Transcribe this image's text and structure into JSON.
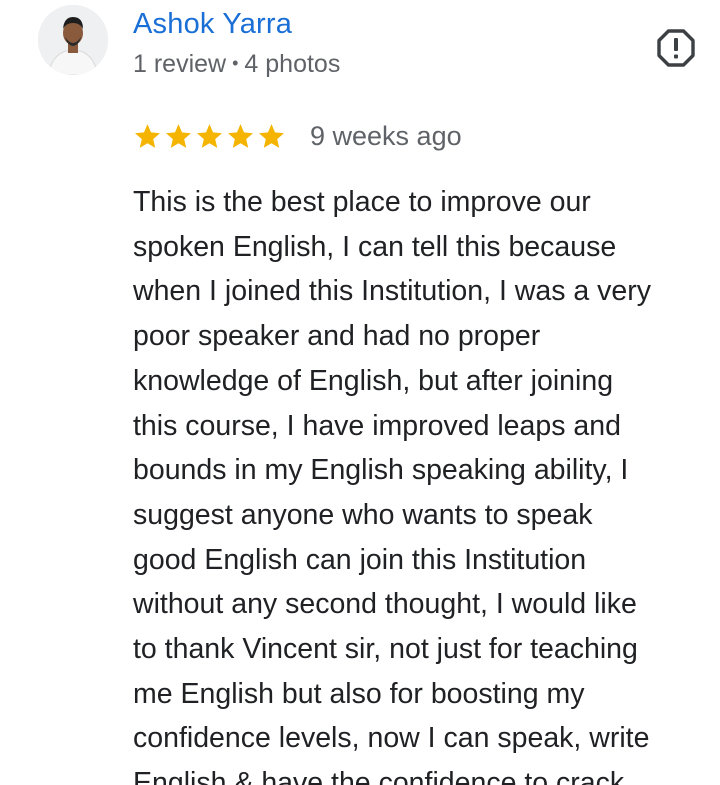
{
  "author": {
    "name": "Ashok Yarra",
    "reviews": "1 review",
    "separator": "•",
    "photos": "4 photos"
  },
  "report_icon": "report-flag-icon",
  "rating": {
    "stars": 5,
    "max": 5,
    "star_color": "#f4b400",
    "date": "9 weeks ago"
  },
  "review": {
    "lines": [
      "This is the best place to improve our",
      "spoken English, I can tell this because",
      "when I joined this Institution, I was a very",
      "poor speaker and had no proper",
      "knowledge of English, but after joining",
      "this course, I have improved leaps and",
      "bounds in my English speaking ability, I",
      "suggest anyone who wants to speak",
      "good English can join this Institution",
      "without any second thought, I would like",
      "to thank Vincent sir, not just for teaching",
      "me English but also for boosting my",
      "confidence levels, now I can speak, write",
      "English & have the confidence to crack"
    ]
  },
  "colors": {
    "name": "#1a6fd6",
    "meta": "#5f6368",
    "text": "#202124",
    "star": "#f4b400"
  }
}
